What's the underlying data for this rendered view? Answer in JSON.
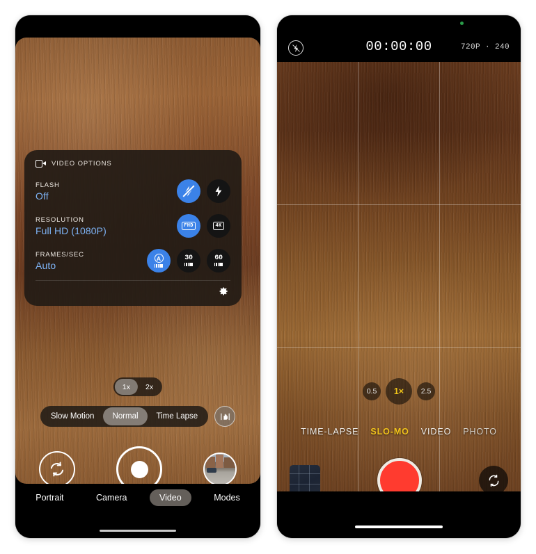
{
  "left_phone": {
    "video_options": {
      "header_label": "VIDEO OPTIONS",
      "header_icon": "video-camera-icon",
      "settings_icon": "gear-icon",
      "rows": [
        {
          "label": "FLASH",
          "value": "Off",
          "buttons": [
            {
              "name": "flash-off-button",
              "icon": "flash-off-icon",
              "selected": true
            },
            {
              "name": "flash-on-button",
              "icon": "flash-on-icon",
              "selected": false
            }
          ]
        },
        {
          "label": "RESOLUTION",
          "value": "Full HD (1080P)",
          "buttons": [
            {
              "name": "resolution-fhd-button",
              "icon": "fhd-badge-icon",
              "text": "FHD",
              "selected": true
            },
            {
              "name": "resolution-4k-button",
              "icon": "4k-badge-icon",
              "text": "4K",
              "selected": false
            }
          ]
        },
        {
          "label": "FRAMES/SEC",
          "value": "Auto",
          "buttons": [
            {
              "name": "fps-auto-button",
              "icon": "auto-fps-icon",
              "text": "A",
              "selected": true
            },
            {
              "name": "fps-30-button",
              "icon": "fps-30-icon",
              "text": "30",
              "selected": false
            },
            {
              "name": "fps-60-button",
              "icon": "fps-60-icon",
              "text": "60",
              "selected": false
            }
          ]
        }
      ]
    },
    "zoom_toggle": {
      "options": [
        {
          "label": "1x",
          "selected": true
        },
        {
          "label": "2x",
          "selected": false
        }
      ]
    },
    "mode_pill": {
      "options": [
        {
          "label": "Slow Motion",
          "selected": false
        },
        {
          "label": "Normal",
          "selected": true
        },
        {
          "label": "Time Lapse",
          "selected": false
        }
      ],
      "stabilize_icon": "hand-stabilization-icon"
    },
    "shutter_row": {
      "flip_icon": "flip-camera-icon",
      "record_label": "record-button",
      "thumbnail_label": "gallery-thumbnail"
    },
    "tabs": [
      {
        "label": "Portrait",
        "selected": false
      },
      {
        "label": "Camera",
        "selected": false
      },
      {
        "label": "Video",
        "selected": true
      },
      {
        "label": "Modes",
        "selected": false
      }
    ]
  },
  "right_phone": {
    "status_bar": {
      "flash_icon": "flash-off-icon",
      "timer": "00:00:00",
      "resolution_info": "720P · 240",
      "privacy_dot": "green-recording-indicator"
    },
    "zoom_options": [
      {
        "label": "0.5",
        "selected": false
      },
      {
        "label": "1×",
        "selected": true
      },
      {
        "label": "2.5",
        "selected": false
      }
    ],
    "modes": [
      {
        "label": "TIME-LAPSE",
        "selected": false
      },
      {
        "label": "SLO-MO",
        "selected": true
      },
      {
        "label": "VIDEO",
        "selected": false
      },
      {
        "label": "PHOTO",
        "selected": false
      }
    ],
    "shutter_row": {
      "thumbnail_label": "gallery-thumbnail",
      "record_label": "record-button",
      "flip_icon": "flip-camera-icon"
    }
  },
  "colors": {
    "accent_blue": "#3b82e8",
    "value_blue": "#7eb3f5",
    "accent_yellow": "#f2c41b",
    "record_red": "#ff3b2f",
    "panel_bg": "#241c16"
  }
}
